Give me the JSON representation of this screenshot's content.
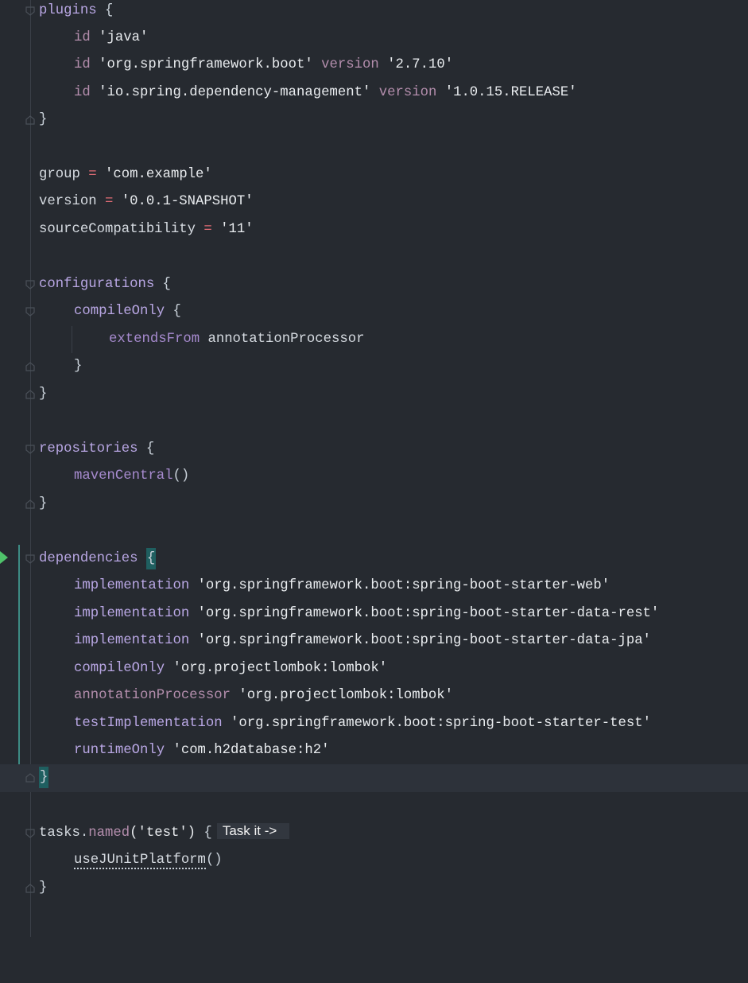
{
  "editor": {
    "lines": {
      "l01": {
        "a": "plugins",
        "b": " {"
      },
      "l02": {
        "a": "id",
        "b": " 'java'"
      },
      "l03": {
        "a": "id",
        "b": " 'org.springframework.boot'",
        "c": " version",
        "d": " '2.7.10'"
      },
      "l04": {
        "a": "id",
        "b": " 'io.spring.dependency-management'",
        "c": " version",
        "d": " '1.0.15.RELEASE'"
      },
      "l05": {
        "a": "}"
      },
      "l07": {
        "a": "group",
        "b": " = ",
        "c": "'com.example'"
      },
      "l08": {
        "a": "version",
        "b": " = ",
        "c": "'0.0.1-SNAPSHOT'"
      },
      "l09": {
        "a": "sourceCompatibility",
        "b": " = ",
        "c": "'11'"
      },
      "l11": {
        "a": "configurations",
        "b": " {"
      },
      "l12": {
        "a": "compileOnly",
        "b": " {"
      },
      "l13": {
        "a": "extendsFrom",
        "b": " annotationProcessor"
      },
      "l14": {
        "a": "}"
      },
      "l15": {
        "a": "}"
      },
      "l17": {
        "a": "repositories",
        "b": " {"
      },
      "l18": {
        "a": "mavenCentral",
        "b": "()"
      },
      "l19": {
        "a": "}"
      },
      "l21": {
        "a": "dependencies",
        "b": " ",
        "c": "{"
      },
      "l22": {
        "a": "implementation",
        "b": " 'org.springframework.boot:spring-boot-starter-web'"
      },
      "l23": {
        "a": "implementation",
        "b": " 'org.springframework.boot:spring-boot-starter-data-rest'"
      },
      "l24": {
        "a": "implementation",
        "b": " 'org.springframework.boot:spring-boot-starter-data-jpa'"
      },
      "l25": {
        "a": "compileOnly",
        "b": " 'org.projectlombok:lombok'"
      },
      "l26": {
        "a": "annotationProcessor",
        "b": " 'org.projectlombok:lombok'"
      },
      "l27": {
        "a": "testImplementation",
        "b": " 'org.springframework.boot:spring-boot-starter-test'"
      },
      "l28": {
        "a": "runtimeOnly",
        "b": " 'com.h2database:h2'"
      },
      "l29": {
        "a": "}"
      },
      "l31": {
        "a": "tasks",
        "b": ".",
        "c": "named",
        "d": "('test')",
        "e": " {",
        "hint": "Task it ->"
      },
      "l32": {
        "a": "useJUnitPlatform",
        "b": "()"
      },
      "l33": {
        "a": "}"
      }
    }
  }
}
